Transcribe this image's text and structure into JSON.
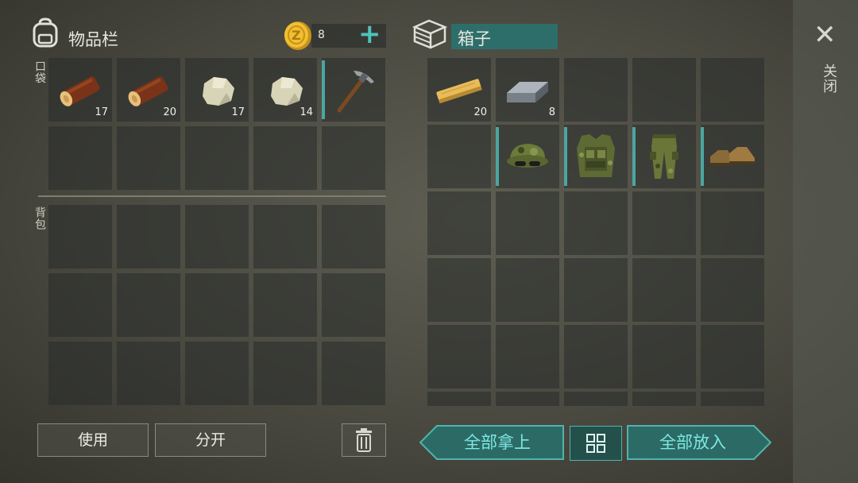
{
  "inventory": {
    "title": "物品栏",
    "coins": "8",
    "add_symbol": "+",
    "pocket_label": "口袋",
    "backpack_label": "背包",
    "pocket_items": [
      {
        "name": "log",
        "count": "17"
      },
      {
        "name": "log",
        "count": "20"
      },
      {
        "name": "stone",
        "count": "17"
      },
      {
        "name": "stone",
        "count": "14"
      },
      {
        "name": "pickaxe",
        "count": ""
      }
    ]
  },
  "box": {
    "title": "箱子",
    "items": [
      {
        "name": "plank",
        "count": "20"
      },
      {
        "name": "iron-ingot",
        "count": "8"
      },
      {
        "name": "camo-hat",
        "count": ""
      },
      {
        "name": "camo-vest",
        "count": ""
      },
      {
        "name": "camo-pants",
        "count": ""
      },
      {
        "name": "boots",
        "count": ""
      }
    ]
  },
  "buttons": {
    "use": "使用",
    "split": "分开",
    "take_all": "全部拿上",
    "put_all": "全部放入"
  },
  "close": {
    "label": "关闭",
    "symbol": "✕"
  },
  "colors": {
    "accent": "#4aa6a0",
    "teal_text": "#7de8e0",
    "slot_bg": "#2c302e"
  }
}
